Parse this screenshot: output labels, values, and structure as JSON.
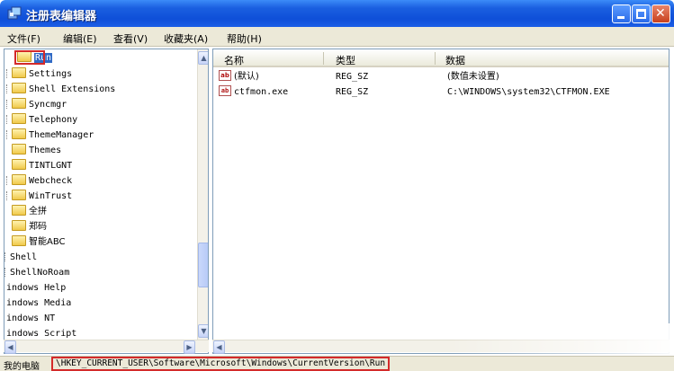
{
  "window": {
    "title": "注册表编辑器",
    "buttons": {
      "close_glyph": "✕"
    }
  },
  "menu": [
    "文件(F)",
    "编辑(E)",
    "查看(V)",
    "收藏夹(A)",
    "帮助(H)"
  ],
  "tree": {
    "selected": "Run",
    "items": [
      "Settings",
      "Shell Extensions",
      "Syncmgr",
      "Telephony",
      "ThemeManager",
      "Themes",
      "TINTLGNT",
      "Webcheck",
      "WinTrust",
      "全拼",
      "郑码",
      "智能ABC"
    ],
    "items_lower": [
      "Shell",
      "ShellNoRoam",
      "indows Help",
      "indows Media",
      "indows NT",
      "indows Script"
    ]
  },
  "list": {
    "columns": [
      "名称",
      "类型",
      "数据"
    ],
    "rows": [
      {
        "name": "(默认)",
        "type": "REG_SZ",
        "data": "(数值未设置)"
      },
      {
        "name": "ctfmon.exe",
        "type": "REG_SZ",
        "data": "C:\\WINDOWS\\system32\\CTFMON.EXE"
      }
    ],
    "value_icon_text": "ab"
  },
  "status": {
    "label": "我的电脑",
    "path": "\\HKEY_CURRENT_USER\\Software\\Microsoft\\Windows\\CurrentVersion\\Run"
  },
  "scroll_arrows": {
    "up": "▲",
    "down": "▼",
    "left": "◀",
    "right": "▶"
  }
}
